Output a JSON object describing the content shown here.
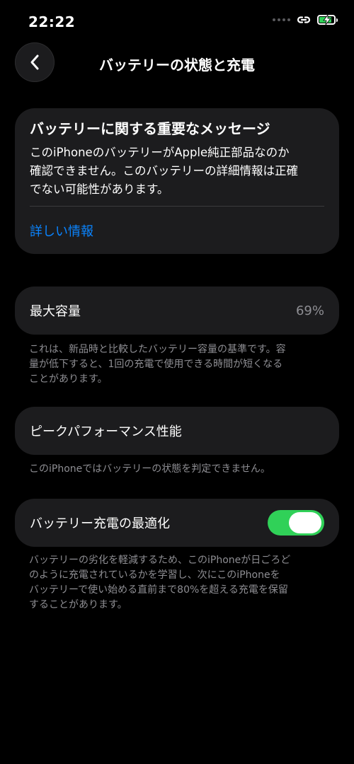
{
  "status_bar": {
    "time": "22:22",
    "battery_level": 0.85,
    "battery_charging": true
  },
  "nav": {
    "title": "バッテリーの状態と充電",
    "back_icon": "chevron-left-icon"
  },
  "message_card": {
    "title": "バッテリーに関する重要なメッセージ",
    "body_lines": [
      "このiPhoneのバッテリーがApple純正部品なのか",
      "確認できません。このバッテリーの詳細情報は正確",
      "でない可能性があります。"
    ],
    "link": "詳しい情報"
  },
  "max_capacity": {
    "label": "最大容量",
    "value": "69%",
    "footnote_lines": [
      "これは、新品時と比較したバッテリー容量の基準です。容",
      "量が低下すると、1回の充電で使用できる時間が短くなる",
      "ことがあります。"
    ]
  },
  "peak_performance": {
    "label": "ピークパフォーマンス性能",
    "footnote": "このiPhoneではバッテリーの状態を判定できません。"
  },
  "optimized_charging": {
    "label": "バッテリー充電の最適化",
    "enabled": true,
    "footnote_lines": [
      "バッテリーの劣化を軽減するため、このiPhoneが日ごろど",
      "のように充電されているかを学習し、次にこのiPhoneを",
      "バッテリーで使い始める直前まで80%を超える充電を保留",
      "することがあります。"
    ]
  },
  "colors": {
    "accent": "#0a84ff",
    "toggle_on": "#30d158",
    "card_bg": "#1c1c1e",
    "secondary_text": "#8e8e93"
  }
}
